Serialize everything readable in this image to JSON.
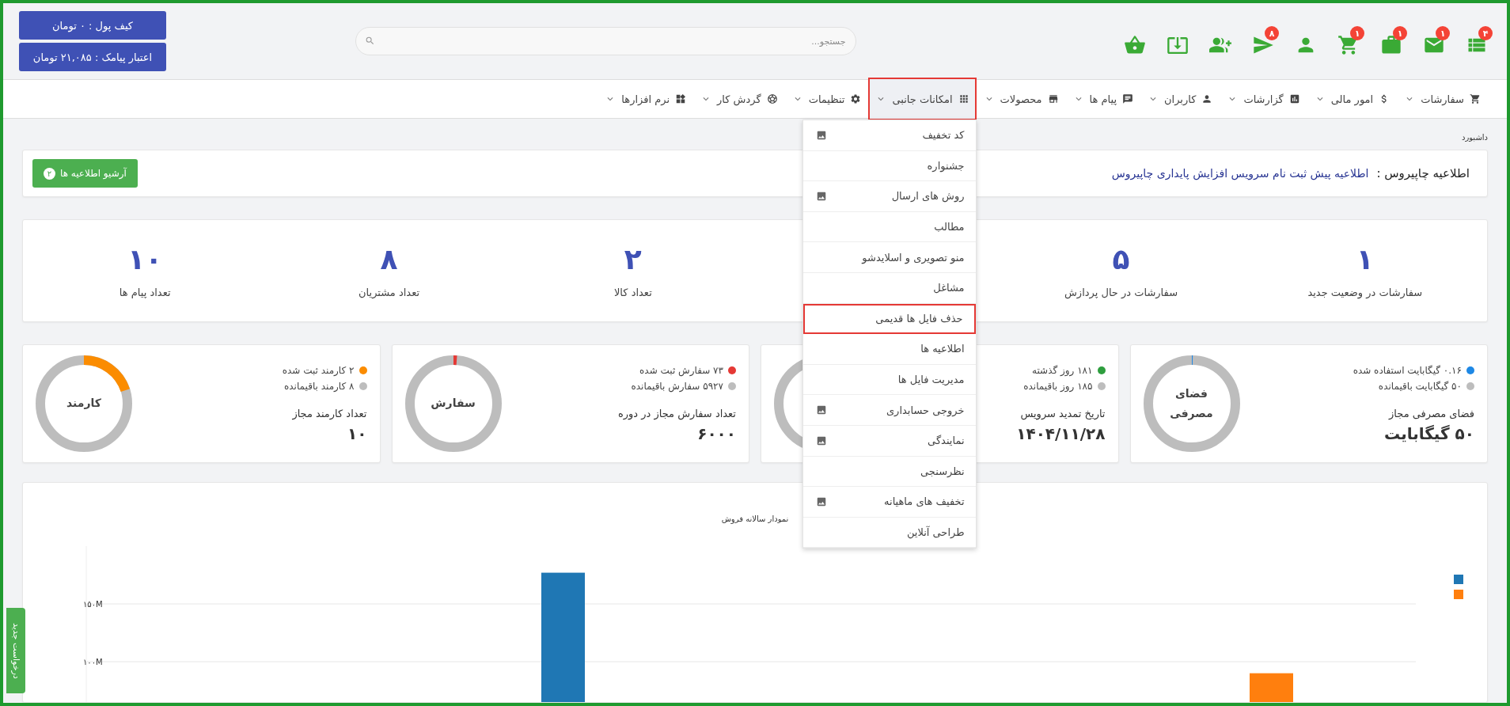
{
  "header": {
    "wallet_button": "کیف پول : ۰ تومان",
    "sms_credit_button": "اعتبار پیامک : ۲۱,۰۸۵ تومان",
    "search": {
      "placeholder": "جستجو..."
    },
    "shortcuts": [
      {
        "has_badge": true,
        "badge": "۴"
      },
      {
        "has_badge": true,
        "badge": "۱"
      },
      {
        "has_badge": true,
        "badge": "۱"
      },
      {
        "has_badge": true,
        "badge": "۱"
      },
      {
        "has_badge": false
      },
      {
        "has_badge": true,
        "badge": "۸"
      },
      {
        "has_badge": false
      },
      {
        "has_badge": false
      },
      {
        "has_badge": false
      }
    ]
  },
  "nav": {
    "items": [
      {
        "label": "سفارشات",
        "expanded": false,
        "highlighted": false
      },
      {
        "label": "امور مالی",
        "expanded": false,
        "highlighted": false
      },
      {
        "label": "گزارشات",
        "expanded": false,
        "highlighted": false
      },
      {
        "label": "کاربران",
        "expanded": false,
        "highlighted": false
      },
      {
        "label": "پیام ها",
        "expanded": false,
        "highlighted": false
      },
      {
        "label": "محصولات",
        "expanded": false,
        "highlighted": false
      },
      {
        "label": "امکانات جانبی",
        "expanded": true,
        "highlighted": true,
        "menu": [
          {
            "label": "کد تخفیف",
            "icon": true,
            "highlighted": false
          },
          {
            "label": "جشنواره",
            "icon": false,
            "highlighted": false
          },
          {
            "label": "روش های ارسال",
            "icon": true,
            "highlighted": false
          },
          {
            "label": "مطالب",
            "icon": false,
            "highlighted": false
          },
          {
            "label": "منو تصویری و اسلایدشو",
            "icon": false,
            "highlighted": false
          },
          {
            "label": "مشاغل",
            "icon": false,
            "highlighted": false
          },
          {
            "label": "حذف فایل ها قدیمی",
            "icon": false,
            "highlighted": true
          },
          {
            "label": "اطلاعیه ها",
            "icon": false,
            "highlighted": false
          },
          {
            "label": "مدیریت فایل ها",
            "icon": false,
            "highlighted": false
          },
          {
            "label": "خروجی حسابداری",
            "icon": true,
            "highlighted": false
          },
          {
            "label": "نمایندگی",
            "icon": true,
            "highlighted": false
          },
          {
            "label": "نظرسنجی",
            "icon": false,
            "highlighted": false
          },
          {
            "label": "تخفیف های ماهیانه",
            "icon": true,
            "highlighted": false
          },
          {
            "label": "طراحی آنلاین",
            "icon": false,
            "highlighted": false
          }
        ]
      },
      {
        "label": "تنظیمات",
        "expanded": false,
        "highlighted": false
      },
      {
        "label": "گردش کار",
        "expanded": false,
        "highlighted": false
      },
      {
        "label": "نرم افزارها",
        "expanded": false,
        "highlighted": false
      }
    ]
  },
  "breadcrumb": "داشبورد",
  "notice": {
    "title": "اطلاعیه چاپیروس :",
    "link": "اطلاعیه پیش ثبت نام سرویس افزایش پایداری چاپیروس",
    "archive_button": "آرشیو اطلاعیه ها",
    "archive_count": "۲"
  },
  "stats": [
    {
      "value": "۱",
      "label": "سفارشات در وضعیت جدید"
    },
    {
      "value": "۵",
      "label": "سفارشات در حال پردازش"
    },
    {
      "value": "۲",
      "label": "تعداد کالا"
    },
    {
      "value": "۸",
      "label": "تعداد مشتریان"
    },
    {
      "value": "۱۰",
      "label": "تعداد پیام ها"
    }
  ],
  "usage_cards": [
    {
      "used": "۰.۱۶ گیگابایت استفاده شده",
      "color": "#1e88e5",
      "remaining": "۵۰ گیگابایت باقیمانده",
      "label": "فضای مصرفی مجاز",
      "value": "۵۰ گیگابایت",
      "donut_label": "فضای مصرفی",
      "level": 0.003
    },
    {
      "used": "۱۸۱ روز گذشته",
      "color": "#2e9e3e",
      "remaining": "۱۸۵ روز باقیمانده",
      "label": "تاریخ تمدید سرویس",
      "value": "۱۴۰۴/۱۱/۲۸"
    },
    {
      "used": "۷۳ سفارش ثبت شده",
      "color": "#e53935",
      "remaining": "۵۹۲۷ سفارش باقیمانده",
      "label": "تعداد سفارش مجاز در دوره",
      "value": "۶۰۰۰",
      "donut_label": "سفارش",
      "level": 0.012
    },
    {
      "used": "۲ کارمند ثبت شده",
      "color": "#fb8c00",
      "remaining": "۸ کارمند باقیمانده",
      "label": "تعداد کارمند مجاز",
      "value": "۱۰",
      "donut_label": "کارمند",
      "level": 0.2
    }
  ],
  "sales_chart": {
    "chart_data": {
      "type": "bar",
      "title": "نمودار سالانه فروش",
      "ylim": [
        0,
        200
      ],
      "yticks": [
        {
          "value": 100,
          "label": "۱۰۰M"
        },
        {
          "value": 150,
          "label": "۱۵۰M"
        }
      ],
      "series": [
        {
          "color": "#1f77b4",
          "values": [
            0,
            0,
            0,
            0,
            177,
            0,
            0,
            0,
            0,
            0,
            0,
            0
          ]
        },
        {
          "color": "#ff7f0e",
          "values": [
            0,
            0,
            0,
            0,
            0,
            0,
            0,
            0,
            0,
            0,
            90,
            0
          ]
        }
      ]
    }
  },
  "side_tab": "درخواست جدید"
}
